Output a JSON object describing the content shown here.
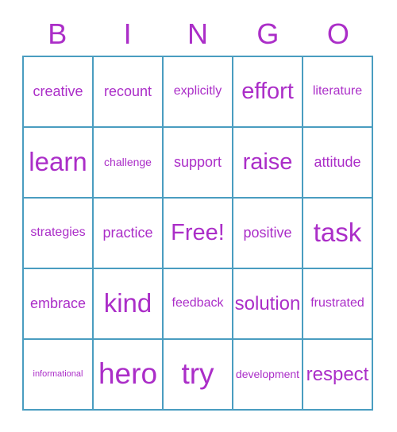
{
  "card": {
    "title": "BINGO",
    "text_color": "#ab2ec8",
    "grid_line_color": "#4a9dc0",
    "background_color": "#ffffff"
  },
  "header": {
    "letters": [
      "B",
      "I",
      "N",
      "G",
      "O"
    ]
  },
  "grid": {
    "columns": 5,
    "rows": 5,
    "free_space": "Free!",
    "cells": [
      [
        {
          "label": "creative",
          "size": "fs-lg"
        },
        {
          "label": "recount",
          "size": "fs-lg"
        },
        {
          "label": "explicitly",
          "size": "fs-md"
        },
        {
          "label": "effort",
          "size": "fs-2xl"
        },
        {
          "label": "literature",
          "size": "fs-md"
        }
      ],
      [
        {
          "label": "learn",
          "size": "fs-3xl"
        },
        {
          "label": "challenge",
          "size": "fs-sm"
        },
        {
          "label": "support",
          "size": "fs-lg"
        },
        {
          "label": "raise",
          "size": "fs-2xl"
        },
        {
          "label": "attitude",
          "size": "fs-lg"
        }
      ],
      [
        {
          "label": "strategies",
          "size": "fs-md"
        },
        {
          "label": "practice",
          "size": "fs-lg"
        },
        {
          "label": "Free!",
          "size": "fs-2xl"
        },
        {
          "label": "positive",
          "size": "fs-lg"
        },
        {
          "label": "task",
          "size": "fs-3xl"
        }
      ],
      [
        {
          "label": "embrace",
          "size": "fs-lg"
        },
        {
          "label": "kind",
          "size": "fs-3xl"
        },
        {
          "label": "feedback",
          "size": "fs-md"
        },
        {
          "label": "solution",
          "size": "fs-xl"
        },
        {
          "label": "frustrated",
          "size": "fs-md"
        }
      ],
      [
        {
          "label": "informational",
          "size": "fs-xs"
        },
        {
          "label": "hero",
          "size": "fs-4xl"
        },
        {
          "label": "try",
          "size": "fs-4xl"
        },
        {
          "label": "development",
          "size": "fs-sm"
        },
        {
          "label": "respect",
          "size": "fs-xl"
        }
      ]
    ]
  }
}
